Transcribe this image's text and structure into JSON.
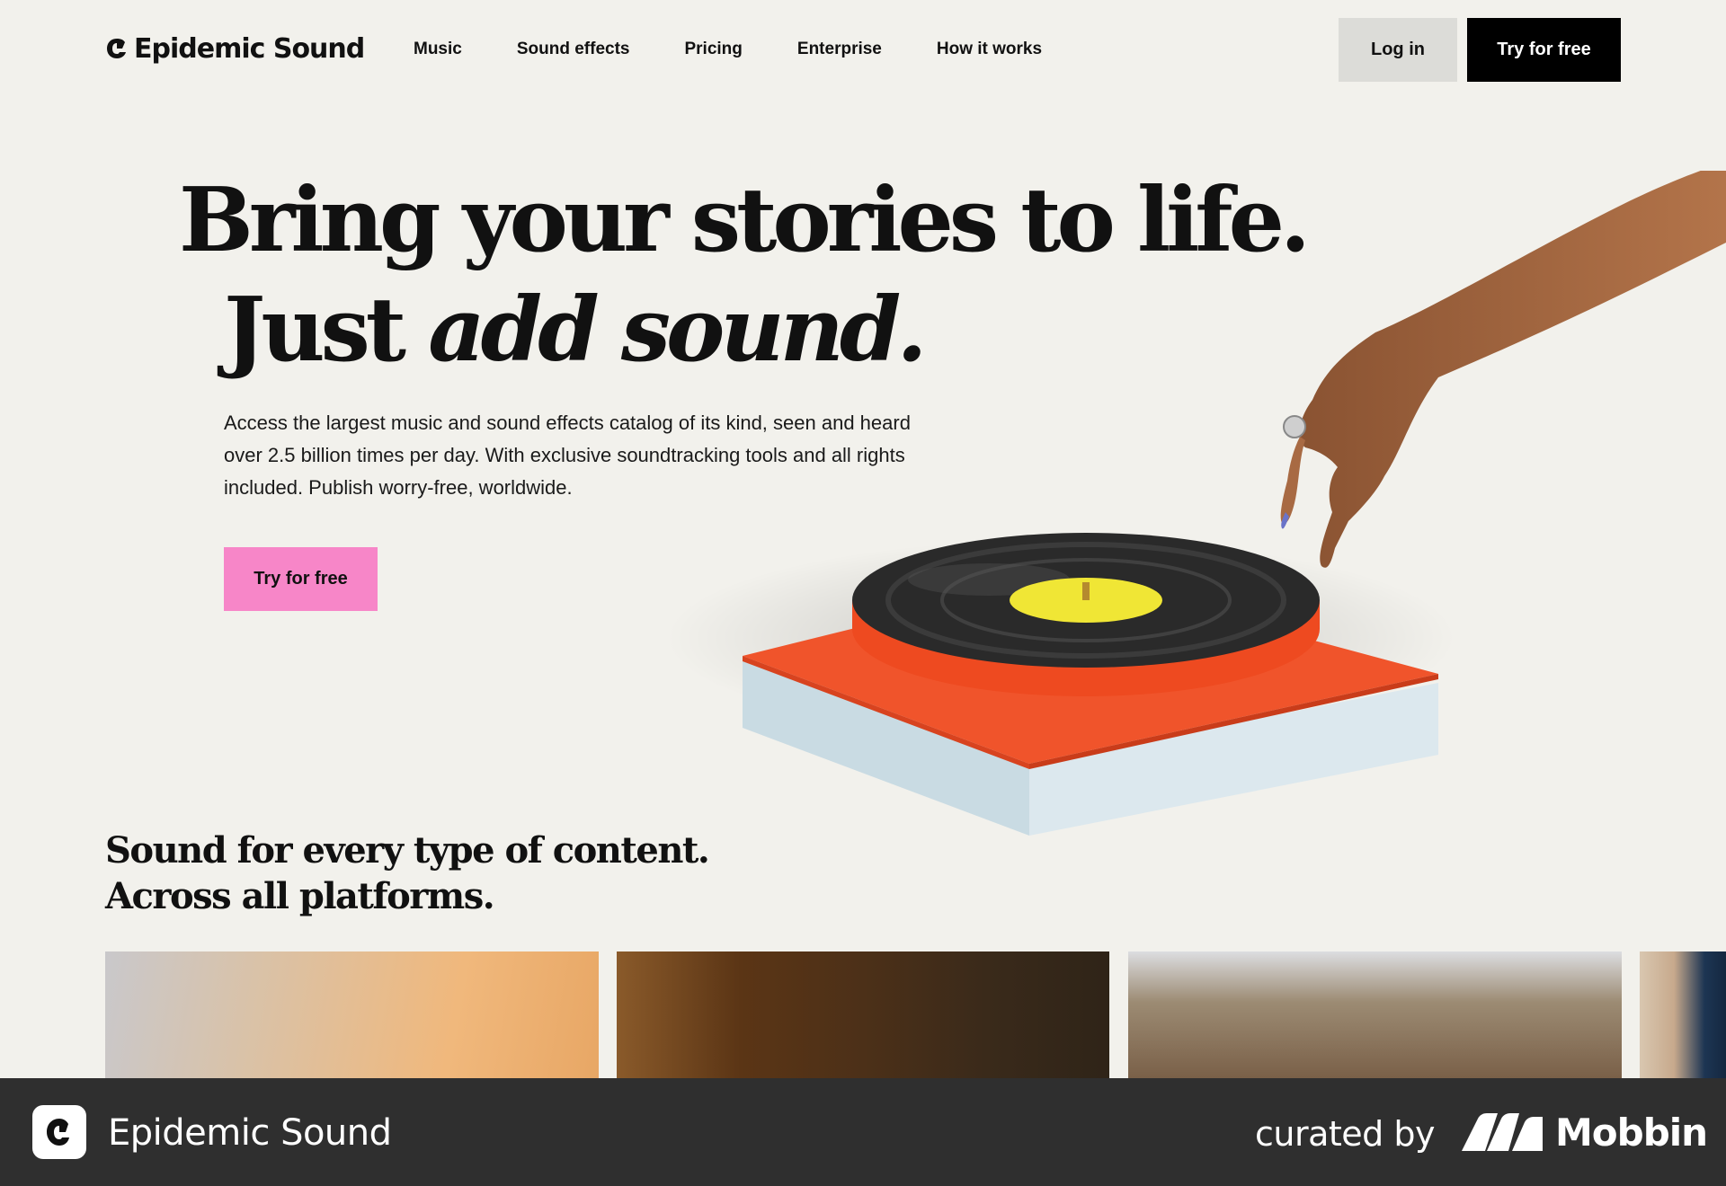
{
  "brand": {
    "name": "Epidemic Sound",
    "logo_icon": "epidemic-sound-logo-icon"
  },
  "nav": {
    "items": [
      {
        "label": "Music"
      },
      {
        "label": "Sound effects"
      },
      {
        "label": "Pricing"
      },
      {
        "label": "Enterprise"
      },
      {
        "label": "How it works"
      }
    ],
    "login_label": "Log in",
    "try_label": "Try for free"
  },
  "hero": {
    "line1": "Bring your stories to life.",
    "line2_regular": "Just ",
    "line2_italic": "add sound.",
    "description": "Access the largest music and sound effects catalog of its kind, seen and heard over 2.5 billion times per day. With exclusive soundtracking tools and all rights included. Publish worry-free, worldwide.",
    "cta_label": "Try for free",
    "cta_color": "#f786c8"
  },
  "section": {
    "title_line1": "Sound for every type of content.",
    "title_line2": "Across all platforms."
  },
  "footer": {
    "app_name": "Epidemic Sound",
    "curated_by": "curated by",
    "curator": "Mobbin"
  },
  "colors": {
    "background": "#f2f1ec",
    "turntable_top": "#f0542b",
    "turntable_base": "#c9dbe3",
    "record_label": "#f0e635",
    "footer_bg": "#2f2f2f"
  }
}
